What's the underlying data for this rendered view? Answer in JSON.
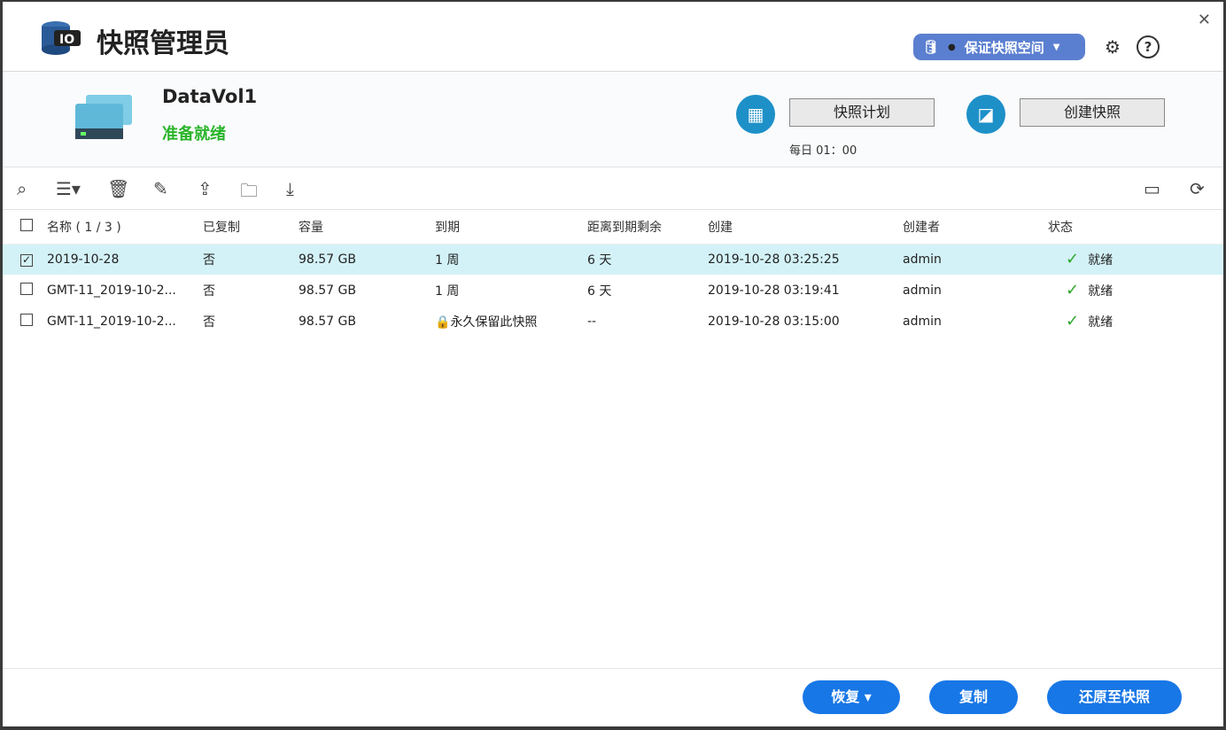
{
  "header": {
    "title": "快照管理员",
    "space_button": "保证快照空间"
  },
  "volume": {
    "name": "DataVol1",
    "status": "准备就绪",
    "schedule_button": "快照计划",
    "schedule": "每日 01：00",
    "create_button": "创建快照"
  },
  "table": {
    "columns": [
      "名称 ( 1 / 3 )",
      "已复制",
      "容量",
      "到期",
      "距离到期剩余",
      "创建",
      "创建者",
      "状态"
    ],
    "rows": [
      {
        "name": "2019-10-28",
        "copied": "否",
        "size": "98.57 GB",
        "expiry": "1 周",
        "remaining": "6 天",
        "created": "2019-10-28 03:25:25",
        "creator": "admin",
        "status": "就绪",
        "checked": true
      },
      {
        "name": "GMT-11_2019-10-2...",
        "copied": "否",
        "size": "98.57 GB",
        "expiry": "1 周",
        "remaining": "6 天",
        "created": "2019-10-28 03:19:41",
        "creator": "admin",
        "status": "就绪",
        "checked": false
      },
      {
        "name": "GMT-11_2019-10-2...",
        "copied": "否",
        "size": "98.57 GB",
        "expiry": "永久保留此快照",
        "remaining": "--",
        "created": "2019-10-28 03:15:00",
        "creator": "admin",
        "status": "就绪",
        "checked": false
      }
    ]
  },
  "footer": {
    "restore": "恢复",
    "copy": "复制",
    "revert": "还原至快照"
  }
}
